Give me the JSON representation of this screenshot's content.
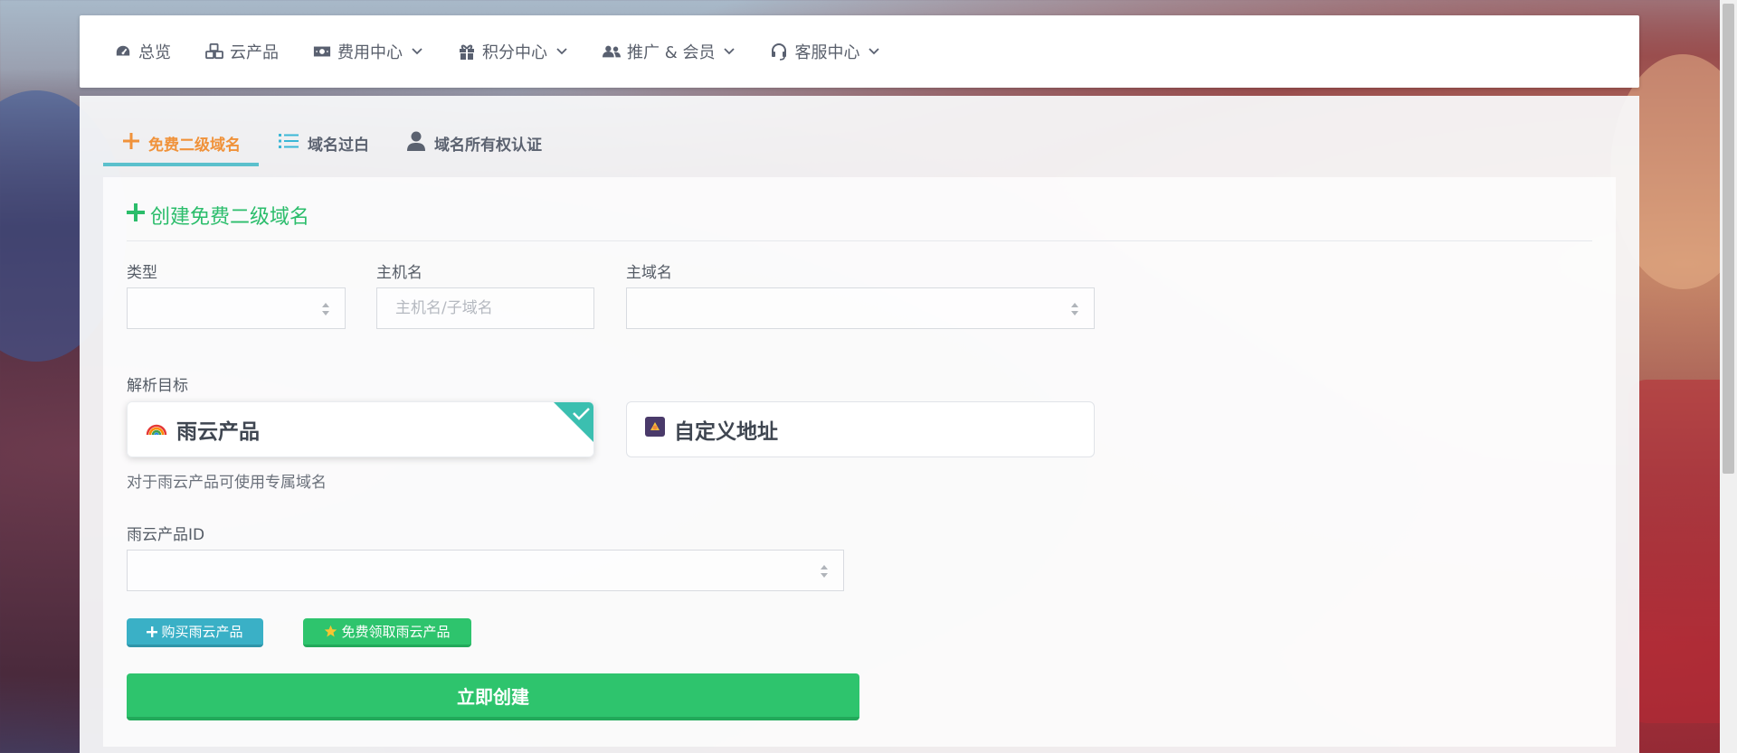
{
  "nav": {
    "items": [
      {
        "label": "总览",
        "icon": "dashboard-icon",
        "has_dropdown": false
      },
      {
        "label": "云产品",
        "icon": "cubes-icon",
        "has_dropdown": false
      },
      {
        "label": "费用中心",
        "icon": "money-bill-icon",
        "has_dropdown": true
      },
      {
        "label": "积分中心",
        "icon": "gift-icon",
        "has_dropdown": true
      },
      {
        "label": "推广 & 会员",
        "icon": "users-icon",
        "has_dropdown": true
      },
      {
        "label": "客服中心",
        "icon": "headset-icon",
        "has_dropdown": true
      }
    ]
  },
  "tabs": [
    {
      "label": "免费二级域名",
      "icon": "plus-icon",
      "active": true
    },
    {
      "label": "域名过白",
      "icon": "list-icon",
      "active": false
    },
    {
      "label": "域名所有权认证",
      "icon": "user-icon",
      "active": false
    }
  ],
  "form": {
    "title": "创建免费二级域名",
    "type_label": "类型",
    "type_value": "",
    "host_label": "主机名",
    "host_placeholder": "主机名/子域名",
    "main_domain_label": "主域名",
    "main_domain_value": "",
    "target_label": "解析目标",
    "target_options": [
      {
        "label": "雨云产品",
        "icon": "rainbow-icon",
        "selected": true
      },
      {
        "label": "自定义地址",
        "icon": "custom-address-icon",
        "selected": false
      }
    ],
    "target_hint": "对于雨云产品可使用专属域名",
    "product_id_label": "雨云产品ID",
    "product_id_value": "",
    "buy_button": "购买雨云产品",
    "free_button": "免费领取雨云产品",
    "submit_button": "立即创建"
  },
  "colors": {
    "accent_green": "#2ec46d",
    "tab_active_orange": "#f0923a",
    "tab_underline": "#5bc0cc",
    "buy_button": "#3ab0c6",
    "free_button": "#2ec46d",
    "check_corner": "#3bbfb0"
  }
}
